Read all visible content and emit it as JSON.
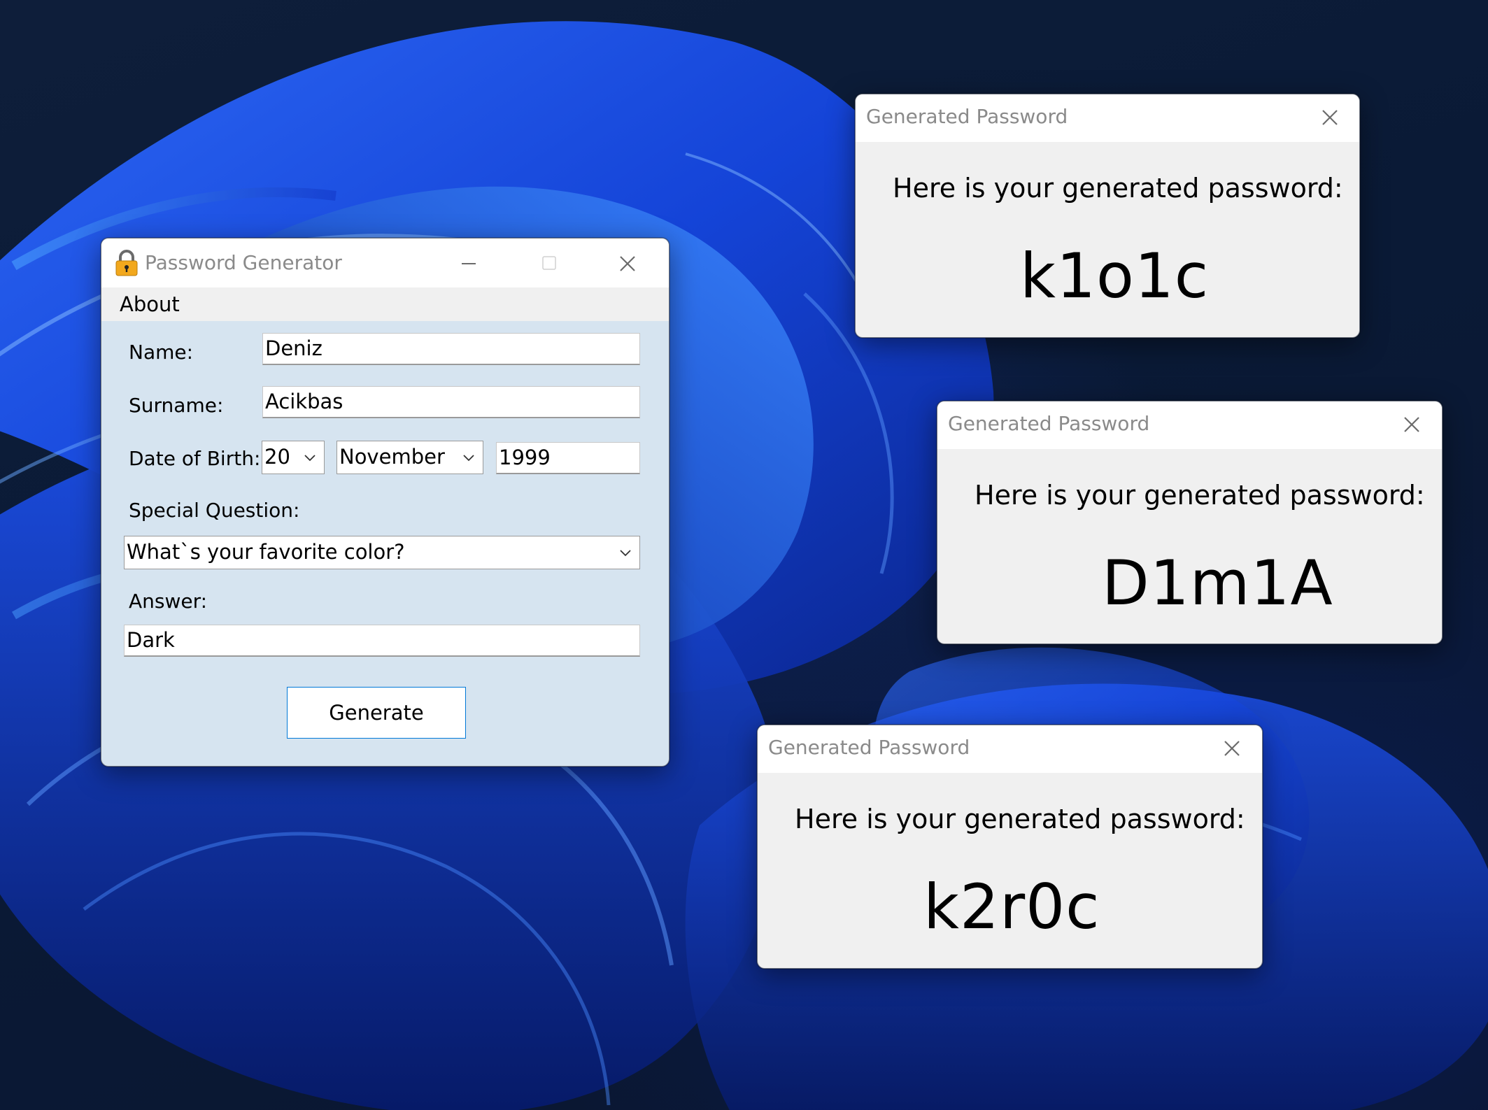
{
  "main_window": {
    "title": "Password Generator",
    "icon": "padlock-icon",
    "menu": {
      "about": "About"
    },
    "form": {
      "name_label": "Name:",
      "name_value": "Deniz",
      "surname_label": "Surname:",
      "surname_value": "Acikbas",
      "dob_label": "Date of Birth:",
      "dob_day": "20",
      "dob_month": "November",
      "dob_year": "1999",
      "question_label": "Special Question:",
      "question_value": "What`s your favorite color?",
      "answer_label": "Answer:",
      "answer_value": "Dark"
    },
    "generate_label": "Generate"
  },
  "popups": [
    {
      "title": "Generated Password",
      "message": "Here is your generated password:",
      "password": "k1o1c"
    },
    {
      "title": "Generated Password",
      "message": "Here is your generated password:",
      "password": "D1m1A"
    },
    {
      "title": "Generated Password",
      "message": "Here is your generated password:",
      "password": "k2r0c"
    }
  ],
  "colors": {
    "accent": "#0078d7",
    "form_background": "#d6e4f0",
    "dialog_background": "#f0f0f0",
    "title_text": "#8a8a8a"
  }
}
